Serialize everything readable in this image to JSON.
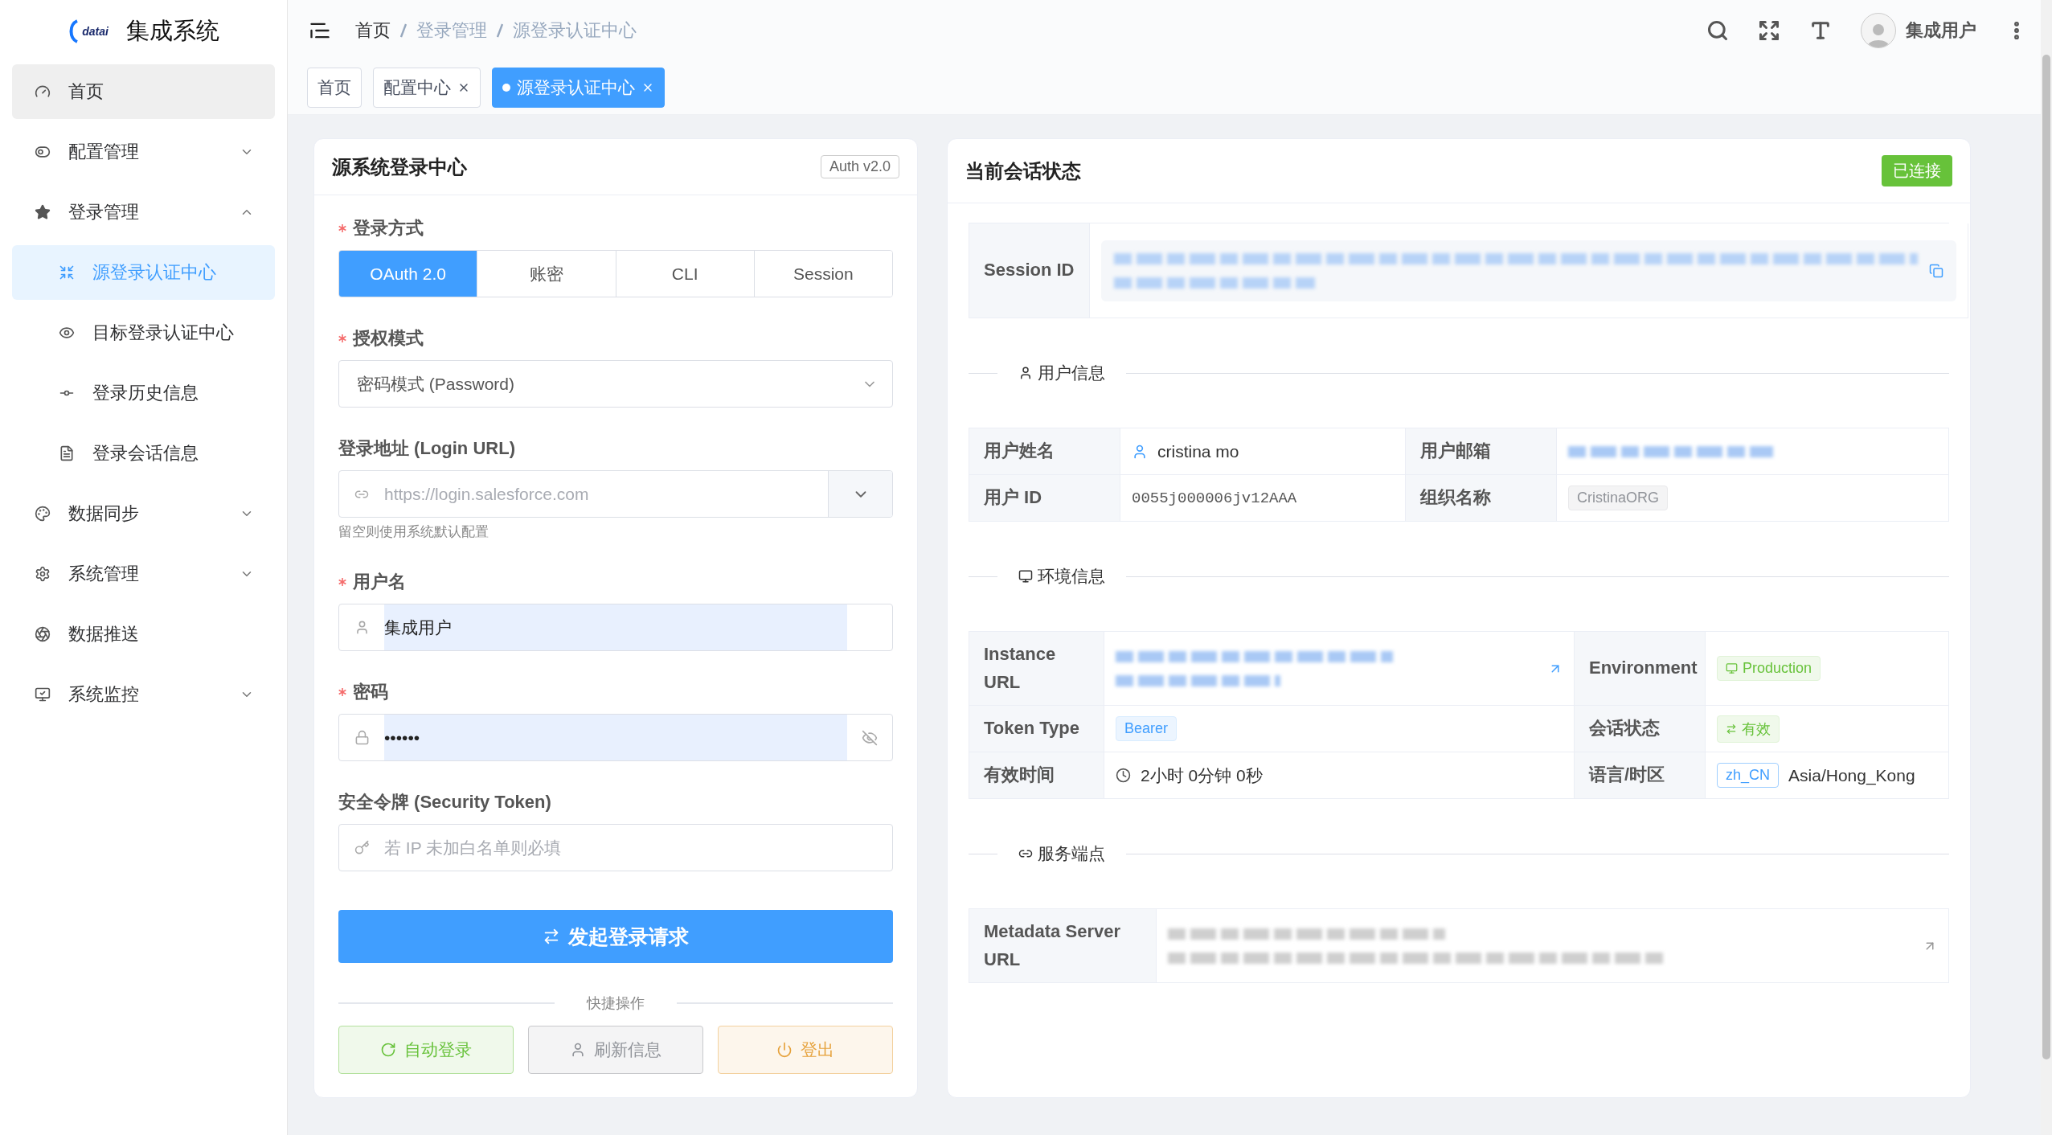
{
  "sidebar": {
    "logo_text": "datai",
    "app_title": "集成系统",
    "items": [
      {
        "label": "首页",
        "hovered": true,
        "selected": false
      },
      {
        "label": "配置管理",
        "hovered": false,
        "selected": false,
        "expanded": false
      },
      {
        "label": "登录管理",
        "hovered": false,
        "selected": false,
        "expanded": true,
        "children": [
          {
            "label": "源登录认证中心",
            "selected": true
          },
          {
            "label": "目标登录认证中心",
            "selected": false
          },
          {
            "label": "登录历史信息",
            "selected": false
          },
          {
            "label": "登录会话信息",
            "selected": false
          }
        ]
      },
      {
        "label": "数据同步",
        "hovered": false,
        "selected": false,
        "expanded": false
      },
      {
        "label": "系统管理",
        "hovered": false,
        "selected": false,
        "expanded": false
      },
      {
        "label": "数据推送",
        "hovered": false,
        "selected": false
      },
      {
        "label": "系统监控",
        "hovered": false,
        "selected": false,
        "expanded": false
      }
    ]
  },
  "header": {
    "breadcrumb": [
      "首页",
      "登录管理",
      "源登录认证中心"
    ],
    "user_name": "集成用户"
  },
  "tabs": [
    {
      "label": "首页",
      "selected": false,
      "closable": false
    },
    {
      "label": "配置中心",
      "selected": false,
      "closable": true
    },
    {
      "label": "源登录认证中心",
      "selected": true,
      "closable": true
    }
  ],
  "login_form": {
    "title": "源系统登录中心",
    "badge": "Auth v2.0",
    "fields": [
      {
        "kind": "segmented",
        "label": "登录方式",
        "required": true,
        "options": [
          {
            "label": "OAuth 2.0",
            "selected": true
          },
          {
            "label": "账密",
            "selected": false
          },
          {
            "label": "CLI",
            "selected": false
          },
          {
            "label": "Session",
            "selected": false
          }
        ]
      },
      {
        "kind": "select",
        "label": "授权模式",
        "required": true,
        "value": "密码模式 (Password)"
      },
      {
        "kind": "url",
        "label": "登录地址 (Login URL)",
        "required": false,
        "placeholder": "https://login.salesforce.com",
        "hint": "留空则使用系统默认配置"
      },
      {
        "kind": "text",
        "label": "用户名",
        "required": true,
        "value": "集成用户",
        "autofilled": true
      },
      {
        "kind": "password",
        "label": "密码",
        "required": true,
        "value": "••••••",
        "autofilled": true
      },
      {
        "kind": "token",
        "label": "安全令牌 (Security Token)",
        "required": false,
        "placeholder": "若 IP 未加白名单则必填"
      }
    ],
    "submit": "发起登录请求",
    "quick_title": "快捷操作",
    "quick_actions": [
      {
        "label": "自动登录",
        "kind": "success"
      },
      {
        "label": "刷新信息",
        "kind": "info"
      },
      {
        "label": "登出",
        "kind": "warning"
      }
    ]
  },
  "session": {
    "title": "当前会话状态",
    "status": "已连接",
    "id_label": "Session ID",
    "sections": [
      {
        "kind": "user",
        "title": "用户信息",
        "rows": [
          [
            {
              "label": "用户姓名",
              "value": {
                "kind": "user",
                "text": "cristina mo"
              }
            },
            {
              "label": "用户邮箱",
              "value": {
                "kind": "blurred"
              }
            }
          ],
          [
            {
              "label": "用户 ID",
              "value": {
                "kind": "mono",
                "text": "0055j000006jv12AAA"
              }
            },
            {
              "label": "组织名称",
              "value": {
                "kind": "tag",
                "text": "CristinaORG"
              }
            }
          ]
        ]
      },
      {
        "kind": "env",
        "title": "环境信息",
        "rows": [
          [
            {
              "label": "Instance URL",
              "value": {
                "kind": "blurred-link"
              }
            },
            {
              "label": "Environment",
              "value": {
                "kind": "env-tag",
                "text": "Production"
              }
            }
          ],
          [
            {
              "label": "Token Type",
              "value": {
                "kind": "type-tag",
                "text": "Bearer"
              }
            },
            {
              "label": "会话状态",
              "value": {
                "kind": "status-tag",
                "text": "有效"
              }
            }
          ],
          [
            {
              "label": "有效时间",
              "value": {
                "kind": "duration",
                "text": "2小时 0分钟 0秒"
              }
            },
            {
              "label": "语言/时区",
              "value": {
                "kind": "locale",
                "tag": "zh_CN",
                "text": "Asia/Hong_Kong"
              }
            }
          ]
        ]
      },
      {
        "kind": "link",
        "title": "服务端点",
        "rows": [
          [
            {
              "label": "Metadata Server URL",
              "value": {
                "kind": "blurred-link-muted"
              }
            }
          ]
        ]
      }
    ]
  }
}
